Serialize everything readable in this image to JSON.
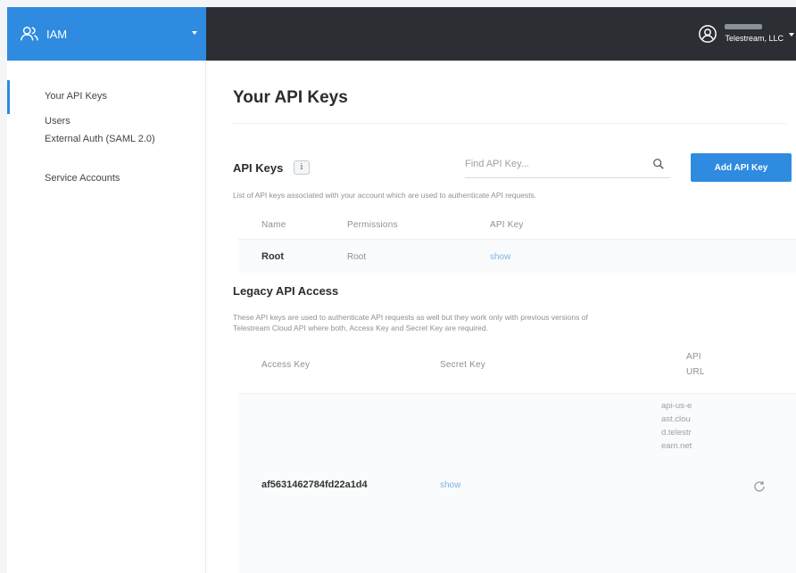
{
  "app": {
    "name": "IAM"
  },
  "account": {
    "org": "Telestream, LLC"
  },
  "sidebar": {
    "items": [
      {
        "label": "Your API Keys",
        "active": true
      },
      {
        "label": "Users"
      },
      {
        "label": "External Auth (SAML 2.0)"
      },
      {
        "label": "Service Accounts"
      }
    ]
  },
  "main": {
    "title": "Your API Keys",
    "api_keys": {
      "heading": "API Keys",
      "info": "i",
      "search_placeholder": "Find API Key...",
      "add_button": "Add API Key",
      "description": "List of API keys associated with your account which are used to authenticate API requests.",
      "columns": [
        "Name",
        "Permissions",
        "API Key"
      ],
      "rows": [
        {
          "name": "Root",
          "permissions": "Root",
          "api_key": "show"
        }
      ]
    },
    "legacy": {
      "heading": "Legacy API Access",
      "description_line1": "These API keys are used to authenticate API requests as well but they work only with previous versions of",
      "description_line2": "Telestream Cloud API where both, Access Key and Secret Key are required.",
      "columns": {
        "access_key": "Access Key",
        "secret_key": "Secret Key",
        "api_url": "API URL"
      },
      "rows": [
        {
          "access_key": "af5631462784fd22a1d4",
          "secret_key": "show",
          "api_url": "api-us-east.cloud.telestream.net"
        }
      ]
    }
  },
  "colors": {
    "accent": "#2e8be0",
    "topbar": "#2b2f33",
    "link": "#7fb2e5"
  }
}
